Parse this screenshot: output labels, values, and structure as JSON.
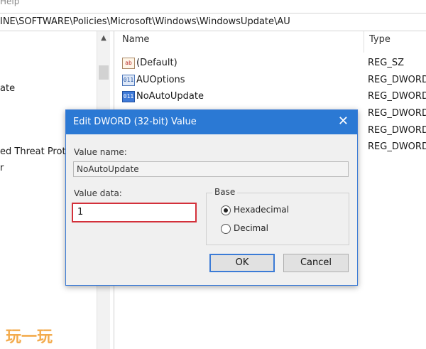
{
  "menu": {
    "help_label": "Help"
  },
  "address": {
    "path": "INE\\SOFTWARE\\Policies\\Microsoft\\Windows\\WindowsUpdate\\AU"
  },
  "tree": {
    "items": [
      {
        "label": "ate"
      },
      {
        "label": "ed Threat Prote"
      },
      {
        "label": "r"
      }
    ]
  },
  "list": {
    "headers": {
      "name": "Name",
      "type": "Type"
    },
    "rows": [
      {
        "icon": "string-value-icon",
        "name": "(Default)",
        "type": "REG_SZ"
      },
      {
        "icon": "dword-value-icon",
        "name": "AUOptions",
        "type": "REG_DWORD"
      },
      {
        "icon": "dword-value-icon",
        "name": "NoAutoUpdate",
        "type": "REG_DWORD"
      },
      {
        "icon": "",
        "name": "",
        "type": "REG_DWORD"
      },
      {
        "icon": "",
        "name": "",
        "type": "REG_DWORD"
      },
      {
        "icon": "",
        "name": "",
        "type": "REG_DWORD"
      }
    ]
  },
  "dialog": {
    "title": "Edit DWORD (32-bit) Value",
    "value_name_label": "Value name:",
    "value_name": "NoAutoUpdate",
    "value_data_label": "Value data:",
    "value_data": "1",
    "base_label": "Base",
    "base_options": [
      {
        "label": "Hexadecimal",
        "selected": true
      },
      {
        "label": "Decimal",
        "selected": false
      }
    ],
    "ok_label": "OK",
    "cancel_label": "Cancel"
  },
  "watermark": {
    "text": "玩一玩"
  },
  "colors": {
    "titlebar": "#2b79d4",
    "highlight": "#d3303a",
    "watermark": "#f2a33a"
  }
}
